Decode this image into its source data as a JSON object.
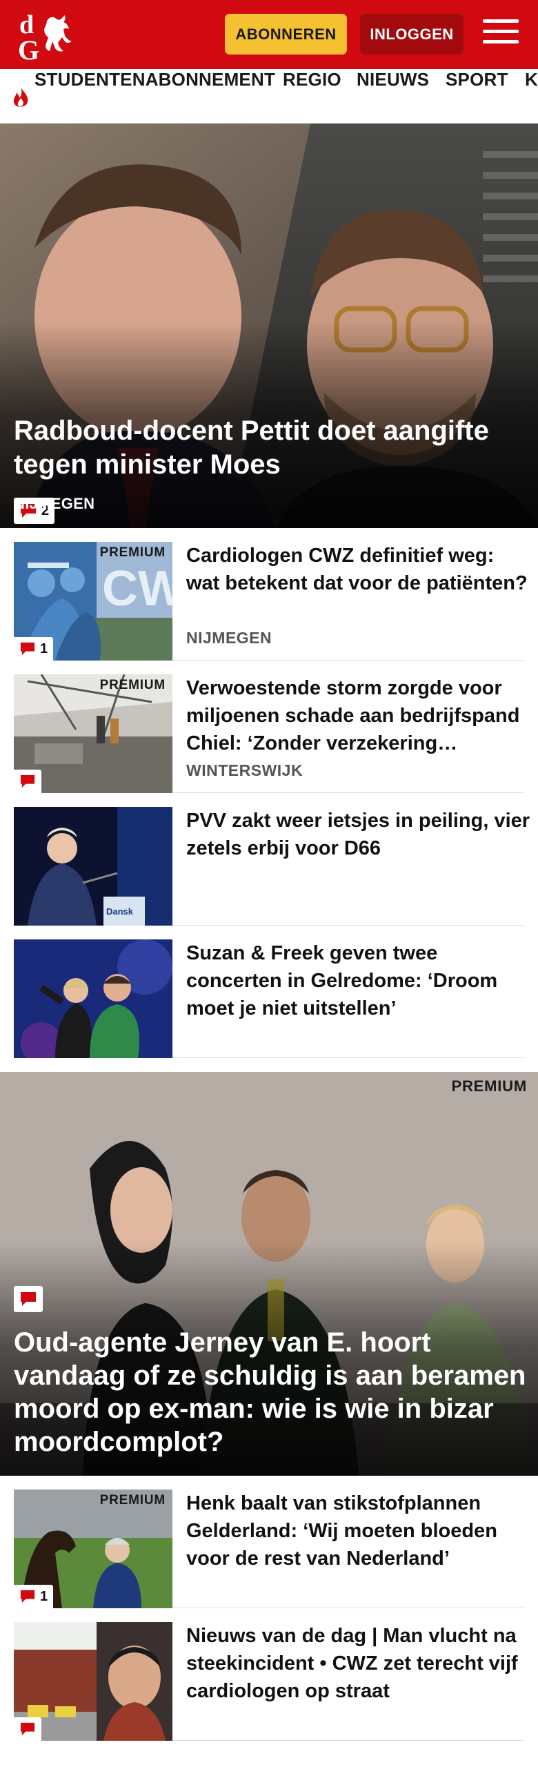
{
  "colors": {
    "brand": "#d10a11",
    "dark_button": "#a30a0e",
    "premium_yellow": "#f5c131",
    "comment_icon": "#d10a11"
  },
  "header": {
    "logo_text": "dG",
    "subscribe_label": "ABONNEREN",
    "login_label": "INLOGGEN",
    "menu_icon": "hamburger-icon"
  },
  "nav": {
    "items": [
      {
        "label": "STUDENTENABONNEMENT",
        "icon": "flame-icon"
      },
      {
        "label": "REGIO"
      },
      {
        "label": "NIEUWS"
      },
      {
        "label": "SPORT"
      },
      {
        "label": "K"
      }
    ]
  },
  "hero": {
    "title": "Radboud-docent Pettit doet aangifte tegen minister Moes",
    "region": "NIJMEGEN",
    "comments": "2"
  },
  "articles": [
    {
      "title": "Cardiologen CWZ definitief weg: wat betekent dat voor de patiënten?",
      "region": "NIJMEGEN",
      "premium": "PREMIUM",
      "comments": "1"
    },
    {
      "title": "Verwoestende storm zorgde voor miljoenen schade aan bedrijfs­pand Chiel: ‘Zonder verzekering…",
      "region": "WINTERSWIJK",
      "premium": "PREMIUM",
      "comments": ""
    },
    {
      "title": "PVV zakt weer ietsjes in peiling, vier zetels erbij voor D66"
    },
    {
      "title": "Suzan & Freek geven twee concerten in Gelredome: ‘Droom moet je niet uitstellen’"
    }
  ],
  "hero2": {
    "title": "Oud-agente Jerney van E. hoort vandaag of ze schuldig is aan beramen moord op ex-man: wie is wie in bizar moordcomplot?",
    "premium": "PREMIUM",
    "comments": ""
  },
  "articles2": [
    {
      "title": "Henk baalt van stikstofplannen Gelderland: ‘Wij moeten bloeden voor de rest van Nederland’",
      "premium": "PREMIUM",
      "comments": "1"
    },
    {
      "title": "Nieuws van de dag | Man vlucht na steekincident • CWZ zet terecht vijf cardiologen op straat",
      "comments": ""
    }
  ]
}
